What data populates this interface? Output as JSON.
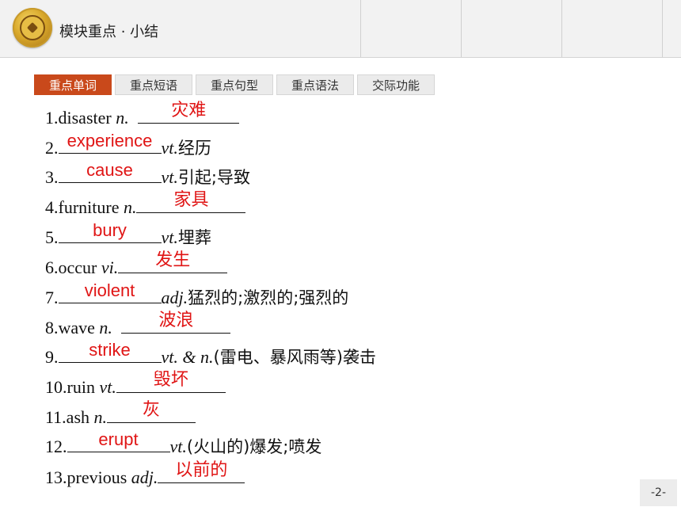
{
  "header": {
    "title": "模块重点 · 小结"
  },
  "tabs": [
    {
      "label": "重点单词",
      "active": true
    },
    {
      "label": "重点短语",
      "active": false
    },
    {
      "label": "重点句型",
      "active": false
    },
    {
      "label": "重点语法",
      "active": false
    },
    {
      "label": "交际功能",
      "active": false
    }
  ],
  "items": [
    {
      "prefix": "1.disaster ",
      "pos": "n.",
      "answer": "灾难",
      "meaning": ""
    },
    {
      "prefix": "2.",
      "pos": "vt.",
      "answer": "experience",
      "meaning": "经历"
    },
    {
      "prefix": "3.",
      "pos": "vt.",
      "answer": "cause",
      "meaning": "引起;导致"
    },
    {
      "prefix": "4.furniture ",
      "pos": "n.",
      "answer": "家具",
      "meaning": ""
    },
    {
      "prefix": "5.",
      "pos": "vt.",
      "answer": "bury",
      "meaning": "埋葬"
    },
    {
      "prefix": "6.occur ",
      "pos": "vi.",
      "answer": "发生",
      "meaning": ""
    },
    {
      "prefix": "7.",
      "pos": "adj.",
      "answer": "violent",
      "meaning": "猛烈的;激烈的;强烈的"
    },
    {
      "prefix": "8.wave ",
      "pos": "n.",
      "answer": "波浪",
      "meaning": ""
    },
    {
      "prefix": "9.",
      "pos": "vt. & n.",
      "answer": "strike",
      "meaning": "(雷电、暴风雨等)袭击"
    },
    {
      "prefix": "10.ruin ",
      "pos": "vt.",
      "answer": "毁坏",
      "meaning": ""
    },
    {
      "prefix": "11.ash ",
      "pos": "n.",
      "answer": "灰",
      "meaning": ""
    },
    {
      "prefix": "12.",
      "pos": "vt.",
      "answer": "erupt",
      "meaning": "(火山的)爆发;喷发"
    },
    {
      "prefix": "13.previous ",
      "pos": "adj.",
      "answer": "以前的",
      "meaning": ""
    }
  ],
  "page_number": "-2-",
  "colors": {
    "accent": "#c9491b",
    "answer": "#e01515"
  }
}
